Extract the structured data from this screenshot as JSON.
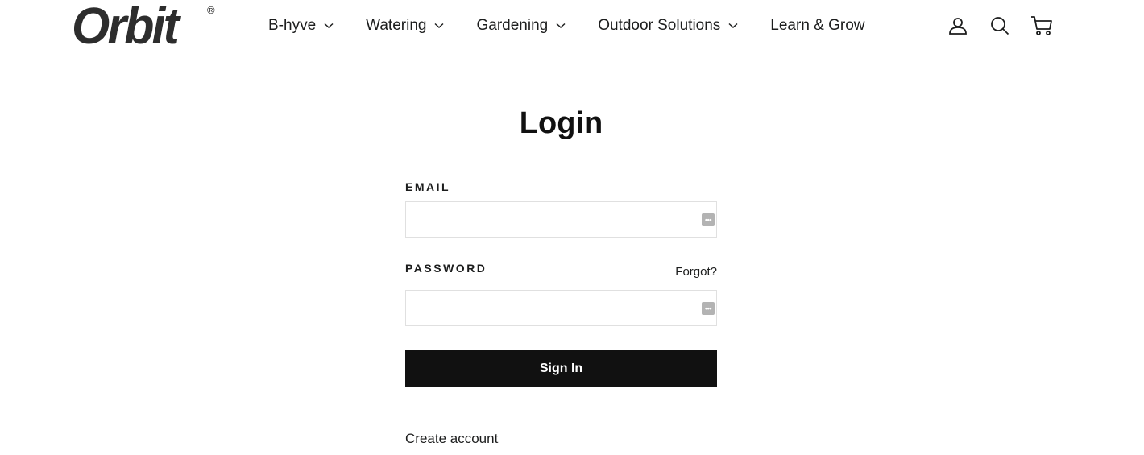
{
  "brand": {
    "logo_text": "Orbit",
    "logo_mark": "®"
  },
  "nav": {
    "items": [
      {
        "label": "B-hyve",
        "has_dropdown": true
      },
      {
        "label": "Watering",
        "has_dropdown": true
      },
      {
        "label": "Gardening",
        "has_dropdown": true
      },
      {
        "label": "Outdoor Solutions",
        "has_dropdown": true
      },
      {
        "label": "Learn & Grow",
        "has_dropdown": false
      }
    ]
  },
  "header_icons": [
    "account-icon",
    "search-icon",
    "cart-icon"
  ],
  "login": {
    "title": "Login",
    "email_label": "EMAIL",
    "email_value": "",
    "password_label": "PASSWORD",
    "password_value": "",
    "forgot_label": "Forgot?",
    "submit_label": "Sign In",
    "create_account_label": "Create account"
  },
  "colors": {
    "text": "#1c1d1d",
    "button_bg": "#111111",
    "button_text": "#ffffff",
    "input_border": "#e0e0e0"
  }
}
